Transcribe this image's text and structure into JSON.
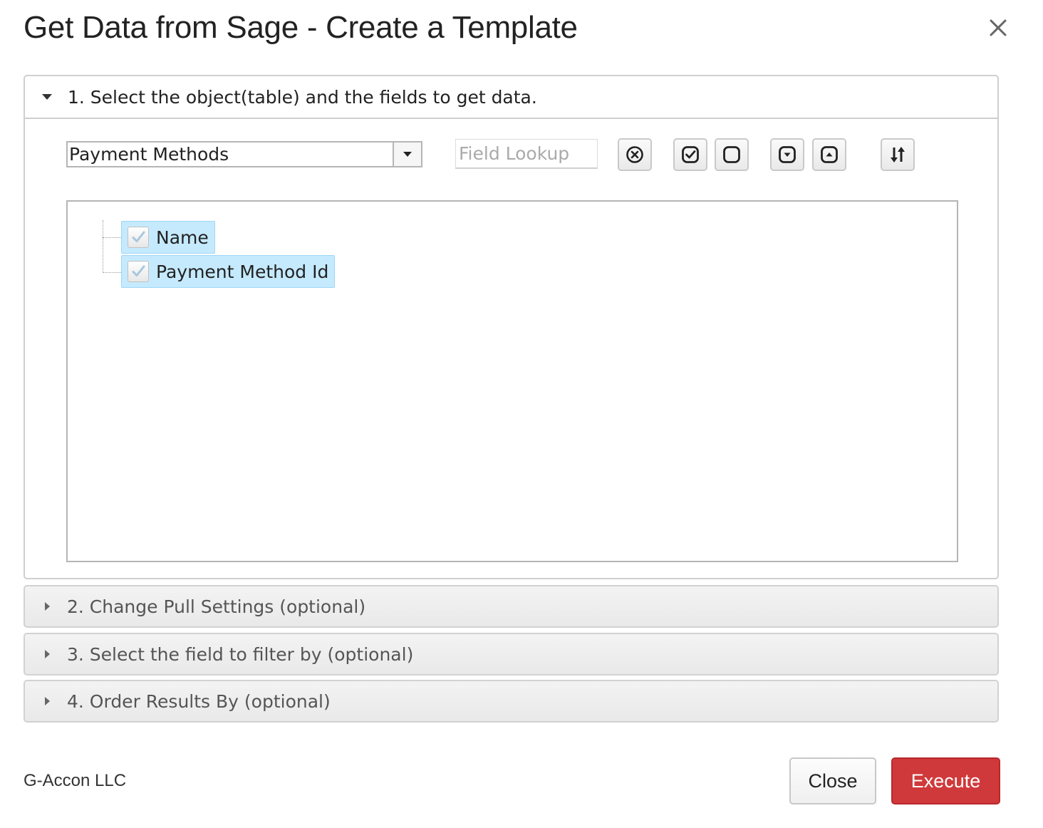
{
  "dialog": {
    "title": "Get Data from Sage - Create a Template",
    "close_icon": "close-icon"
  },
  "sections": [
    {
      "number": 1,
      "title": "1. Select the object(table) and the fields to get data.",
      "expanded": true
    },
    {
      "number": 2,
      "title": "2. Change Pull Settings (optional)",
      "expanded": false
    },
    {
      "number": 3,
      "title": "3. Select the field to filter by (optional)",
      "expanded": false
    },
    {
      "number": 4,
      "title": "4. Order Results By (optional)",
      "expanded": false
    }
  ],
  "object_select": {
    "selected": "Payment Methods"
  },
  "field_lookup": {
    "placeholder": "Field Lookup",
    "value": ""
  },
  "toolbar": {
    "icons": [
      "clear-circle-x-icon",
      "check-all-icon",
      "uncheck-all-icon",
      "expand-all-icon",
      "collapse-all-icon",
      "sort-icon"
    ]
  },
  "fields": [
    {
      "label": "Name",
      "checked": true
    },
    {
      "label": "Payment Method Id",
      "checked": true
    }
  ],
  "footer": {
    "brand": "G-Accon LLC",
    "close_label": "Close",
    "execute_label": "Execute"
  },
  "colors": {
    "execute": "#d0393b",
    "selected_node": "#c5eafe"
  }
}
